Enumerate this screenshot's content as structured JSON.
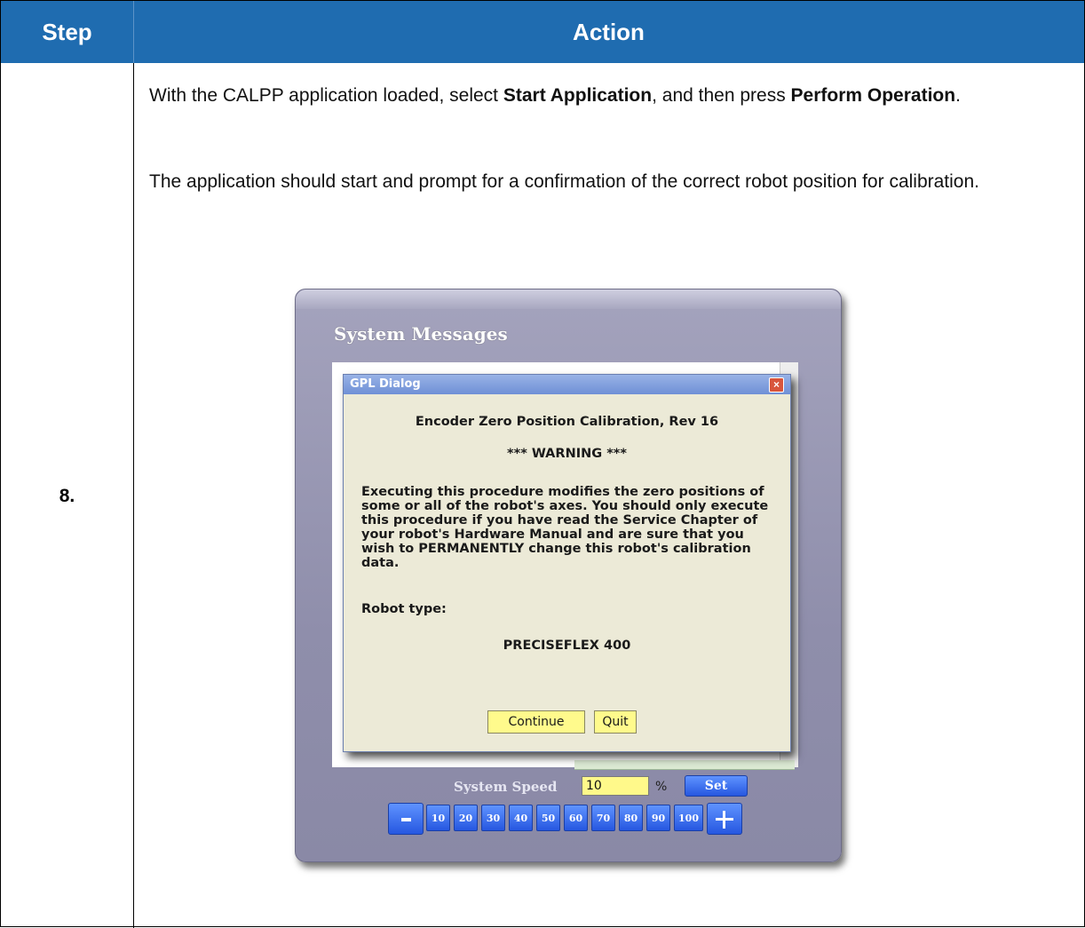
{
  "table": {
    "header_step": "Step",
    "header_action": "Action",
    "step_number": "8."
  },
  "instructions": {
    "p1_before": "With the CALPP application loaded, select ",
    "p1_bold1": "Start Application",
    "p1_mid": ", and then press ",
    "p1_bold2": "Perform Operation",
    "p1_end": ".",
    "p2": "The application should start and prompt for a confirmation of the correct robot position for calibration."
  },
  "screenshot": {
    "panel_title": "System Messages",
    "dialog": {
      "title": "GPL Dialog",
      "heading": "Encoder Zero Position Calibration, Rev 16",
      "warning": "*** WARNING ***",
      "body": "Executing this procedure modifies the zero positions of some or all of the robot's axes. You should only execute this procedure if you have read the Service Chapter of your robot's Hardware Manual and are sure that you wish to PERMANENTLY change this robot's calibration data.",
      "robot_type_label": "Robot type:",
      "robot_type_value": "PRECISEFLEX 400",
      "continue_label": "Continue",
      "quit_label": "Quit"
    },
    "speed": {
      "label": "System Speed",
      "value": "10",
      "unit": "%",
      "set_label": "Set",
      "presets": [
        "10",
        "20",
        "30",
        "40",
        "50",
        "60",
        "70",
        "80",
        "90",
        "100"
      ]
    }
  },
  "colors": {
    "header_bg": "#1f6cb0",
    "panel_bg": "#8f8eab",
    "dialog_bg": "#ecead7",
    "button_yellow": "#fffa8c",
    "button_blue": "#2657e0"
  }
}
